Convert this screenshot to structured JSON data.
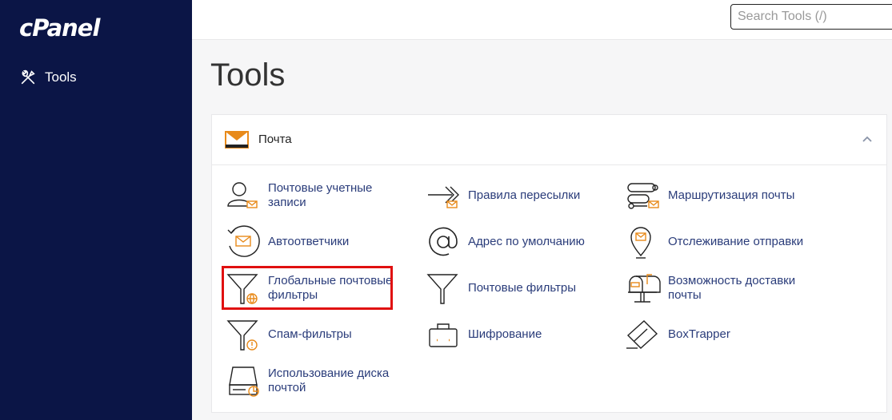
{
  "app": {
    "logo": "cPanel"
  },
  "sidebar": {
    "items": [
      {
        "label": "Tools",
        "icon": "tools-icon"
      }
    ]
  },
  "search": {
    "placeholder": "Search Tools (/)"
  },
  "page": {
    "title": "Tools"
  },
  "section": {
    "title": "Почта",
    "icon": "mail-icon"
  },
  "tools": [
    {
      "label": "Почтовые учетные записи",
      "icon": "email-accounts-icon"
    },
    {
      "label": "Правила пересылки",
      "icon": "forwarders-icon"
    },
    {
      "label": "Маршрутизация почты",
      "icon": "email-routing-icon"
    },
    {
      "label": "Автоответчики",
      "icon": "autoresponders-icon"
    },
    {
      "label": "Адрес по умолчанию",
      "icon": "default-address-icon"
    },
    {
      "label": "Отслеживание отправки",
      "icon": "track-delivery-icon"
    },
    {
      "label": "Глобальные почтовые фильтры",
      "icon": "global-filters-icon"
    },
    {
      "label": "Почтовые фильтры",
      "icon": "email-filters-icon"
    },
    {
      "label": "Возможность доставки почты",
      "icon": "email-deliverability-icon"
    },
    {
      "label": "Спам-фильтры",
      "icon": "spam-filters-icon"
    },
    {
      "label": "Шифрование",
      "icon": "encryption-icon"
    },
    {
      "label": "BoxTrapper",
      "icon": "boxtrapper-icon"
    },
    {
      "label": "Использование диска почтой",
      "icon": "email-disk-usage-icon"
    }
  ],
  "colors": {
    "sidebar": "#0b1546",
    "accent": "#e88a1a",
    "link": "#2a3c7a",
    "highlight": "#e01010"
  }
}
